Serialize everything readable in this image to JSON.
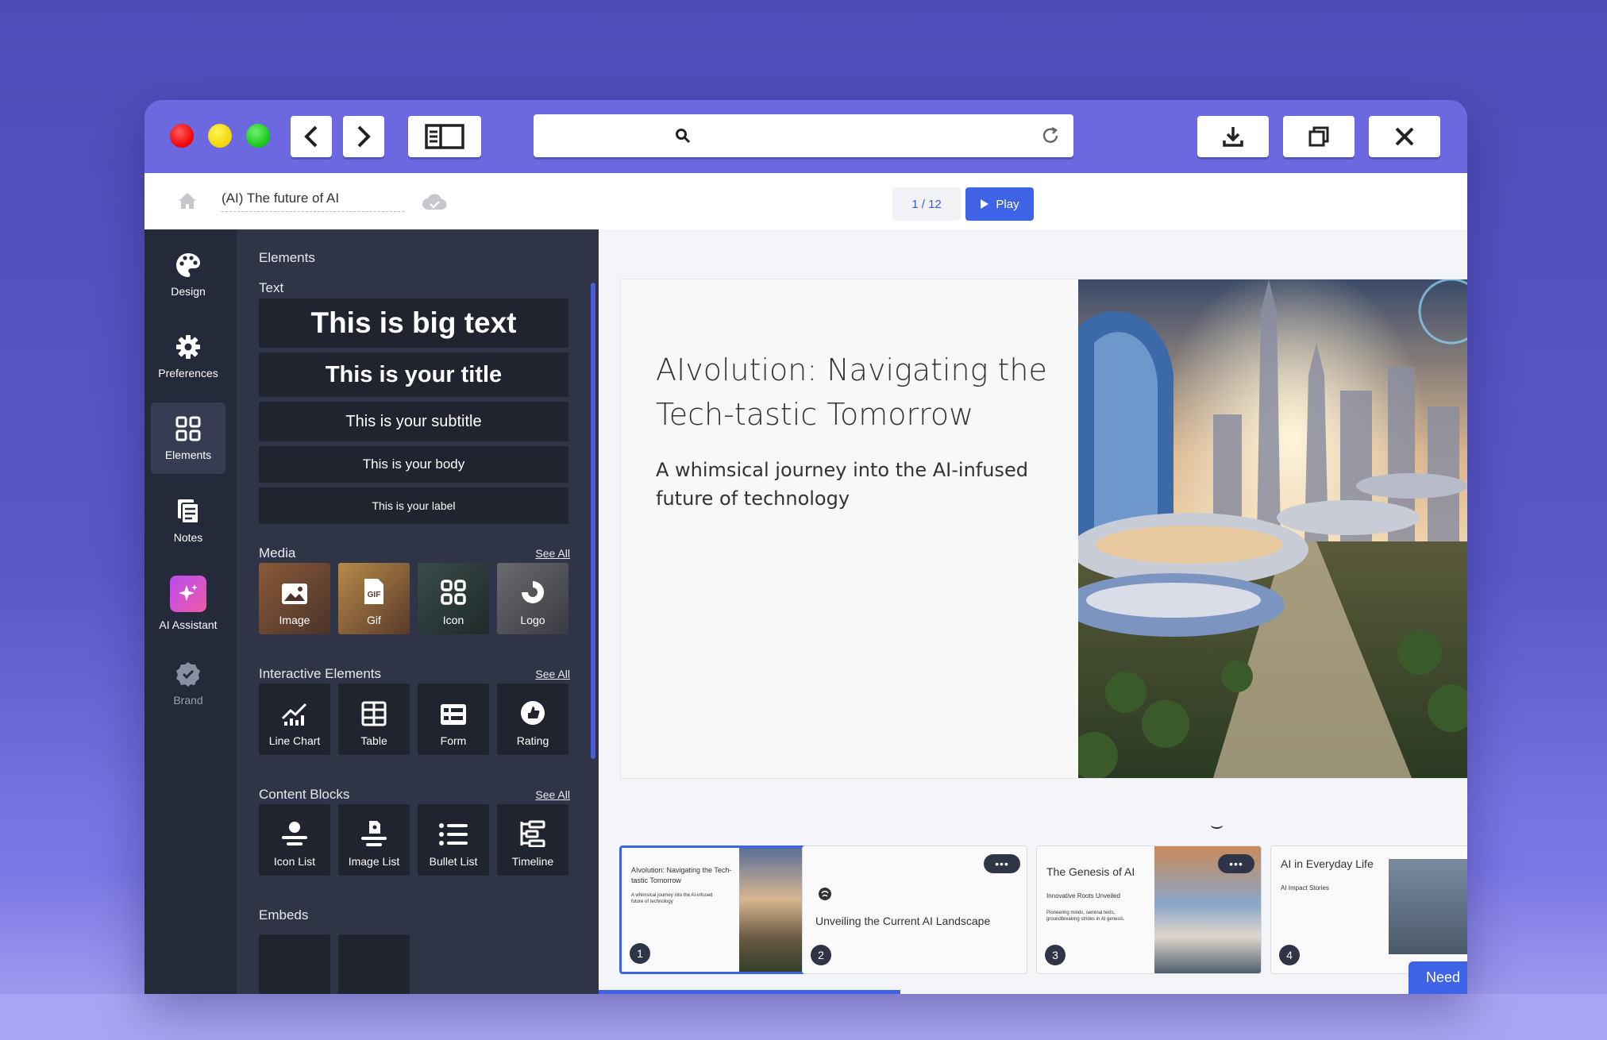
{
  "appbar": {
    "doc_title": "(AI) The future of AI",
    "slide_counter": "1 / 12",
    "play_label": "Play"
  },
  "rail": [
    {
      "label": "Design",
      "icon": "palette-icon"
    },
    {
      "label": "Preferences",
      "icon": "gear-icon"
    },
    {
      "label": "Elements",
      "icon": "grid-icon"
    },
    {
      "label": "Notes",
      "icon": "notes-icon"
    },
    {
      "label": "AI Assistant",
      "icon": "sparkle-icon"
    },
    {
      "label": "Brand",
      "icon": "badge-check-icon"
    }
  ],
  "panel": {
    "heading": "Elements",
    "text_section": "Text",
    "text_items": [
      "This is big text",
      "This is your title",
      "This is your subtitle",
      "This is your body",
      "This is your label"
    ],
    "media_section": "Media",
    "media_items": [
      "Image",
      "Gif",
      "Icon",
      "Logo"
    ],
    "interactive_section": "Interactive Elements",
    "interactive_items": [
      "Line Chart",
      "Table",
      "Form",
      "Rating"
    ],
    "content_section": "Content Blocks",
    "content_items": [
      "Icon List",
      "Image List",
      "Bullet List",
      "Timeline"
    ],
    "embeds_section": "Embeds",
    "see_all": "See All"
  },
  "slide": {
    "title": "AIvolution: Navigating the Tech-tastic Tomorrow",
    "subtitle": "A whimsical journey into the AI-infused future of technology"
  },
  "thumbnails": [
    {
      "num": "1",
      "title": "AIvolution: Navigating the Tech-tastic Tomorrow",
      "body": "A whimsical journey into the AI-infused future of technology"
    },
    {
      "num": "2",
      "title": "Unveiling the Current AI Landscape",
      "body": ""
    },
    {
      "num": "3",
      "title": "The Genesis of AI",
      "sub": "Innovative Roots Unveiled",
      "body": "Pioneering minds, seminal texts, groundbreaking strides in AI genesis."
    },
    {
      "num": "4",
      "title": "AI in Everyday Life",
      "sub": "AI Impact Stories"
    }
  ],
  "thumb_menu": "•••",
  "need_label": "Need",
  "colors": {
    "accent": "#3e63e6",
    "frame": "#6c68e0",
    "panel": "#2f3446",
    "rail": "#252a3a"
  }
}
